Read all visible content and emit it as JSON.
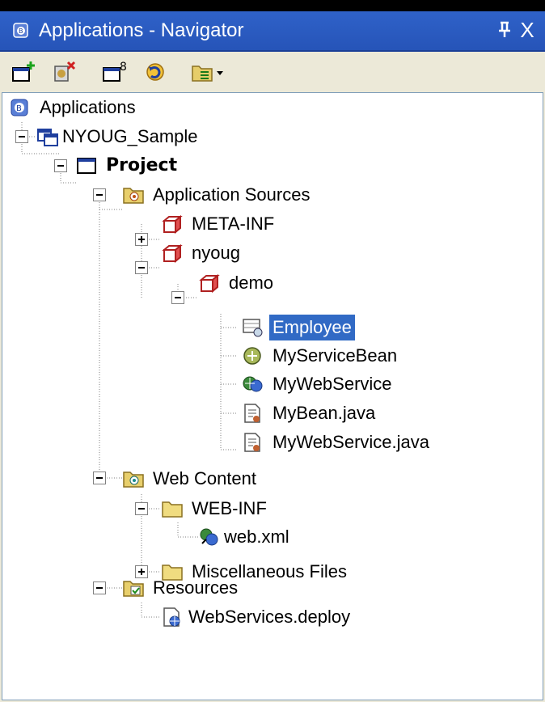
{
  "window": {
    "title": "Applications - Navigator",
    "pin_label": "\u0004",
    "close_label": "X"
  },
  "toolbar": {
    "buttons": [
      {
        "name": "new-application-button",
        "icon": "new-app-icon"
      },
      {
        "name": "remove-button",
        "icon": "remove-icon"
      },
      {
        "name": "new-project-button",
        "icon": "new-project-icon"
      },
      {
        "name": "refresh-button",
        "icon": "refresh-icon"
      },
      {
        "name": "view-dropdown-button",
        "icon": "view-dropdown-icon"
      }
    ]
  },
  "tree": {
    "root": "Applications",
    "app": "NYOUG_Sample",
    "project": "Project",
    "app_sources": "Application Sources",
    "meta_inf": "META-INF",
    "nyoug": "nyoug",
    "demo": "demo",
    "employee": "Employee",
    "my_service_bean": "MyServiceBean",
    "my_web_service": "MyWebService",
    "my_bean_java": "MyBean.java",
    "my_web_service_java": "MyWebService.java",
    "web_content": "Web Content",
    "web_inf": "WEB-INF",
    "web_xml": "web.xml",
    "misc_files": "Miscellaneous Files",
    "resources": "Resources",
    "webservices_deploy": "WebServices.deploy"
  },
  "colors": {
    "title_bar": "#2654b8",
    "selection": "#316ac5",
    "panel": "#ece9d8"
  }
}
